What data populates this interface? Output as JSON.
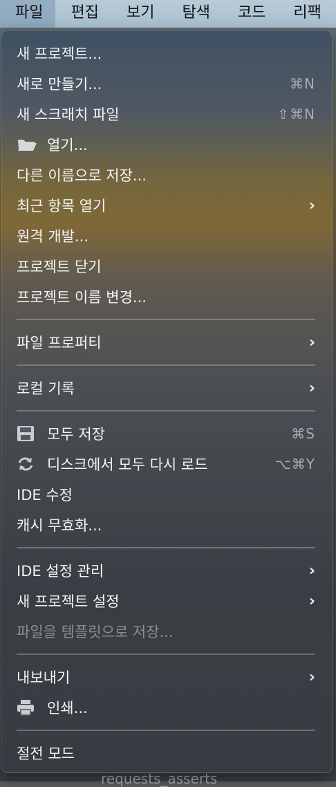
{
  "menubar": {
    "items": [
      "파일",
      "편집",
      "보기",
      "탐색",
      "코드",
      "리팩"
    ]
  },
  "menu": {
    "items": [
      {
        "label": "새 프로젝트..."
      },
      {
        "label": "새로 만들기...",
        "shortcut": "⌘N"
      },
      {
        "label": "새 스크래치 파일",
        "shortcut": "⇧⌘N"
      },
      {
        "label": "열기...",
        "icon": "folder-icon"
      },
      {
        "label": "다른 이름으로 저장..."
      },
      {
        "label": "최근 항목 열기",
        "submenu": true
      },
      {
        "label": "원격 개발..."
      },
      {
        "label": "프로젝트 닫기"
      },
      {
        "label": "프로젝트 이름 변경..."
      },
      {
        "label": "파일 프로퍼티",
        "submenu": true
      },
      {
        "label": "로컬 기록",
        "submenu": true
      },
      {
        "label": "모두 저장",
        "icon": "save-icon",
        "shortcut": "⌘S"
      },
      {
        "label": "디스크에서 모두 다시 로드",
        "icon": "reload-icon",
        "shortcut": "⌥⌘Y"
      },
      {
        "label": "IDE 수정"
      },
      {
        "label": "캐시 무효화..."
      },
      {
        "label": "IDE 설정 관리",
        "submenu": true
      },
      {
        "label": "새 프로젝트 설정",
        "submenu": true
      },
      {
        "label": "파일을 템플릿으로 저장...",
        "disabled": true
      },
      {
        "label": "내보내기",
        "submenu": true
      },
      {
        "label": "인쇄...",
        "icon": "print-icon"
      },
      {
        "label": "절전 모드"
      }
    ],
    "chevron": "›"
  },
  "background": {
    "peek_text": "requests_asserts"
  },
  "colors": {
    "menubar_bg": "#b0c5d4",
    "menu_text": "#f3f4f6",
    "shortcut_text": "#a9adb3",
    "disabled_text": "#8a8e94"
  }
}
